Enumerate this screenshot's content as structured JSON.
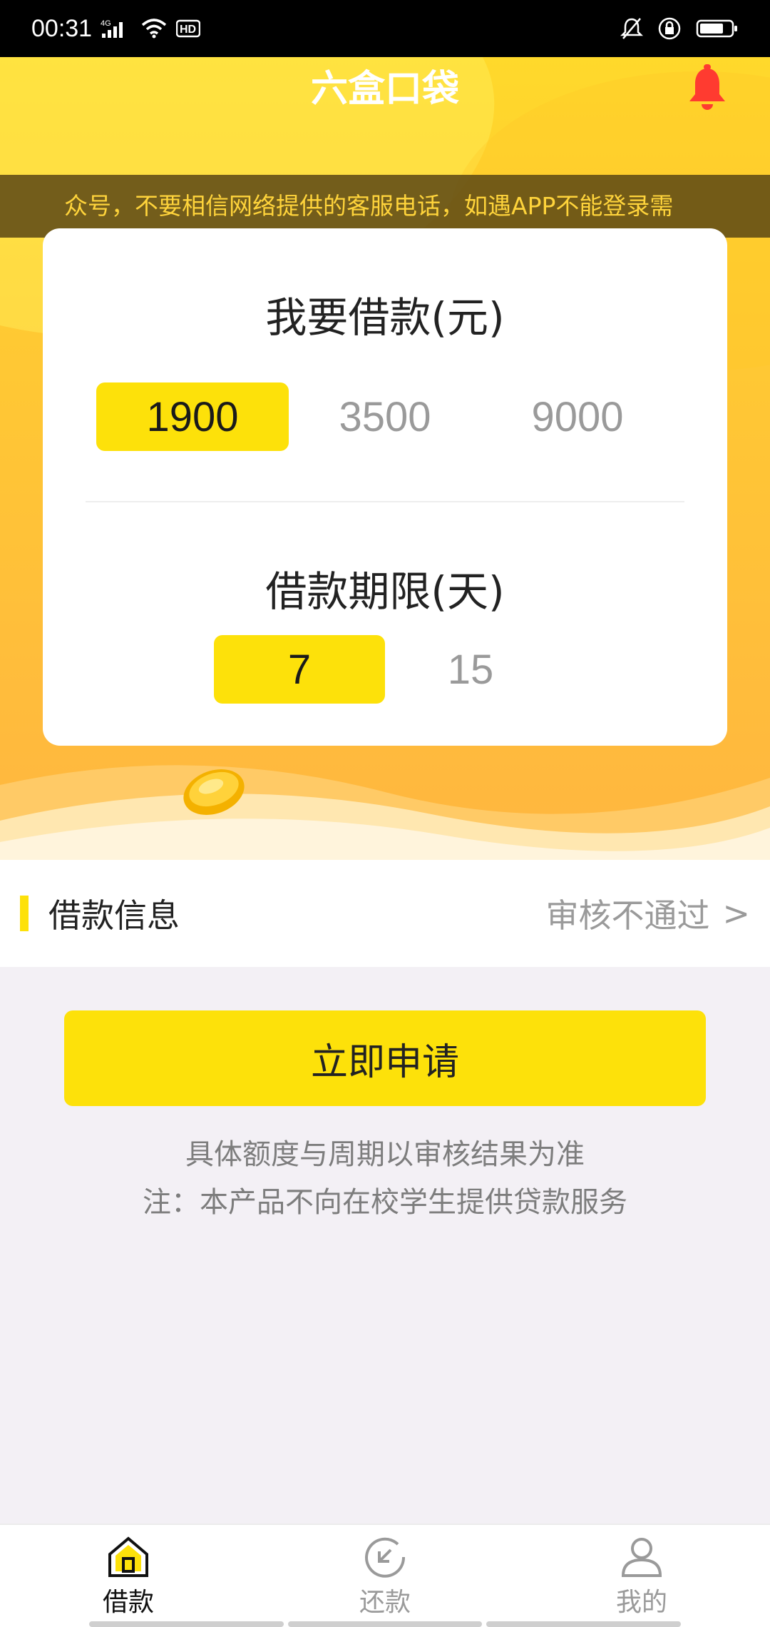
{
  "status_bar": {
    "time": "00:31",
    "network": "4G",
    "hd": "HD"
  },
  "header": {
    "title": "六盒口袋",
    "notice": "众号，不要相信网络提供的客服电话，如遇APP不能登录需"
  },
  "card": {
    "amount_title": "我要借款(元)",
    "amounts": [
      "1900",
      "3500",
      "9000"
    ],
    "selected_amount": "1900",
    "term_title": "借款期限(天)",
    "terms": [
      "7",
      "15"
    ],
    "selected_term": "7"
  },
  "info": {
    "label": "借款信息",
    "status": "审核不通过",
    "chevron": ">"
  },
  "apply": {
    "label": "立即申请",
    "note1": "具体额度与周期以审核结果为准",
    "note2": "注：本产品不向在校学生提供贷款服务"
  },
  "nav": {
    "items": [
      {
        "label": "借款",
        "icon": "home-icon",
        "active": true
      },
      {
        "label": "还款",
        "icon": "repay-icon",
        "active": false
      },
      {
        "label": "我的",
        "icon": "user-icon",
        "active": false
      }
    ]
  },
  "colors": {
    "accent": "#fde10a",
    "bell": "#ff3b30",
    "notice_text": "#ffd43b"
  }
}
